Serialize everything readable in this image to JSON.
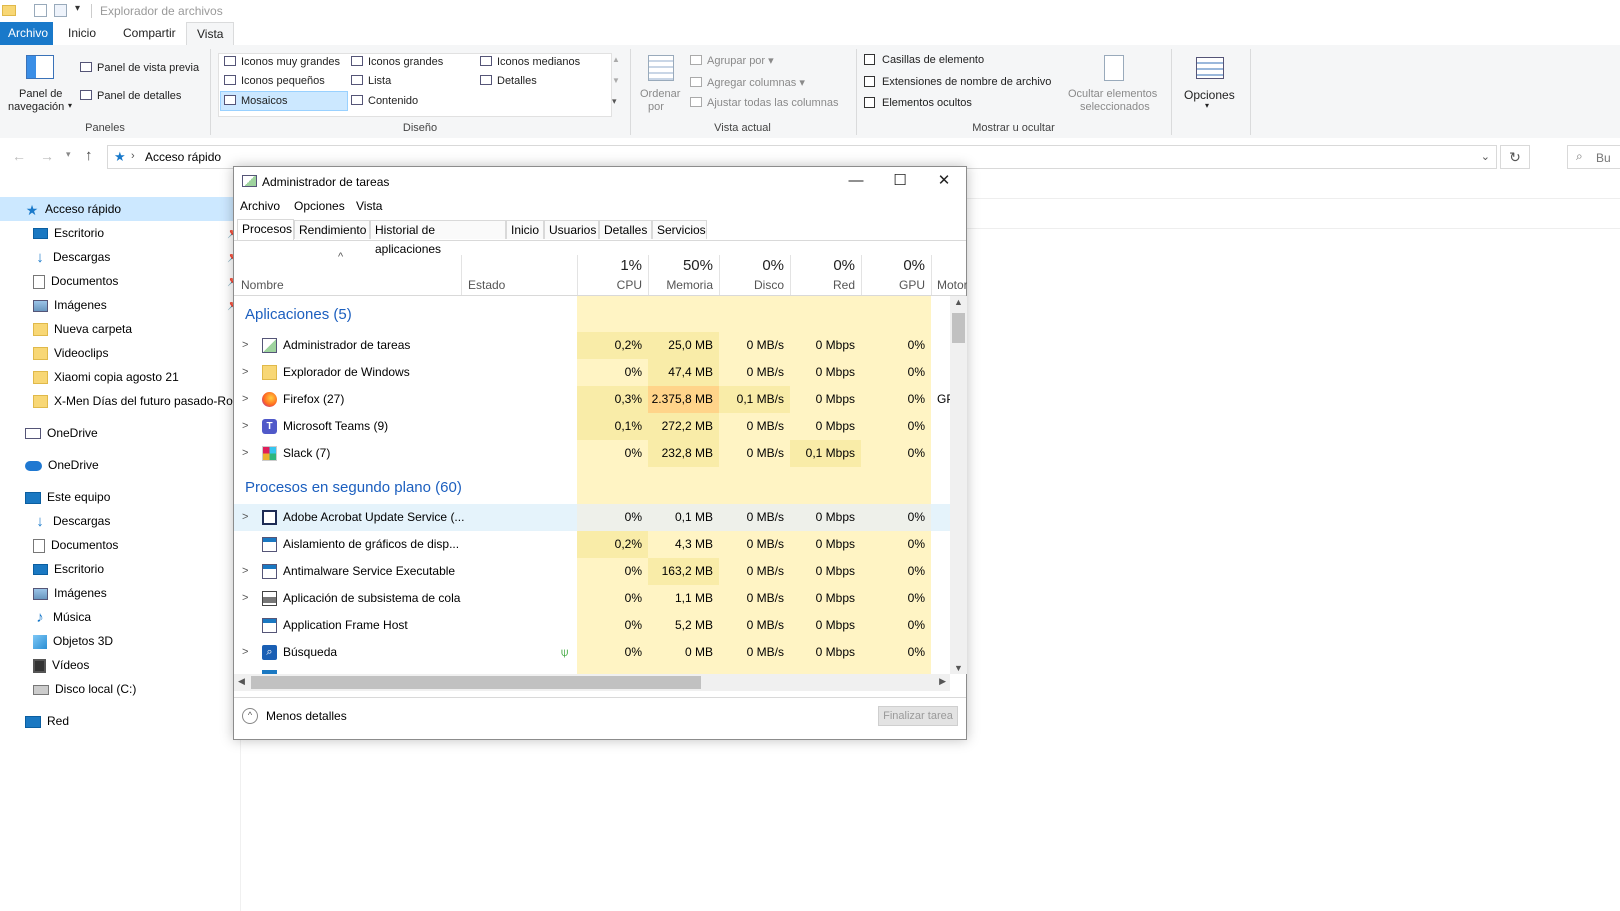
{
  "explorer": {
    "title": "Explorador de archivos",
    "tabs": {
      "file": "Archivo",
      "home": "Inicio",
      "share": "Compartir",
      "view": "Vista"
    },
    "ribbon": {
      "panels": {
        "nav_pane_line1": "Panel de",
        "nav_pane_line2": "navegación",
        "preview": "Panel de vista previa",
        "details": "Panel de detalles",
        "group": "Paneles"
      },
      "layout": {
        "xl_icons": "Iconos muy grandes",
        "l_icons": "Iconos grandes",
        "m_icons": "Iconos medianos",
        "s_icons": "Iconos pequeños",
        "list": "Lista",
        "details": "Detalles",
        "tiles": "Mosaicos",
        "content": "Contenido",
        "group": "Diseño"
      },
      "current_view": {
        "sort_line1": "Ordenar",
        "sort_line2": "por",
        "group_by": "Agrupar por",
        "add_columns": "Agregar columnas",
        "fit_columns": "Ajustar todas las columnas",
        "group": "Vista actual"
      },
      "show_hide": {
        "item_checkboxes": "Casillas de elemento",
        "file_ext": "Extensiones de nombre de archivo",
        "hidden_items": "Elementos ocultos",
        "hide_sel_line1": "Ocultar elementos",
        "hide_sel_line2": "seleccionados",
        "group": "Mostrar u ocultar"
      },
      "options": "Opciones"
    },
    "address": {
      "path": "Acceso rápido",
      "search_placeholder": "Bu"
    },
    "nav": {
      "quick_access": "Acceso rápido",
      "qa_items": [
        "Escritorio",
        "Descargas",
        "Documentos",
        "Imágenes",
        "Nueva carpeta",
        "Videoclips",
        "Xiaomi copia agosto 21",
        "X-Men Días del futuro pasado-Rogu"
      ],
      "onedrive1": "OneDrive",
      "onedrive2": "OneDrive",
      "this_pc": "Este equipo",
      "pc_items": [
        "Descargas",
        "Documentos",
        "Escritorio",
        "Imágenes",
        "Música",
        "Objetos 3D",
        "Vídeos",
        "Disco local (C:)"
      ],
      "network": "Red"
    }
  },
  "taskmgr": {
    "title": "Administrador de tareas",
    "menu": [
      "Archivo",
      "Opciones",
      "Vista"
    ],
    "tabs": [
      "Procesos",
      "Rendimiento",
      "Historial de aplicaciones",
      "Inicio",
      "Usuarios",
      "Detalles",
      "Servicios"
    ],
    "columns": {
      "name": "Nombre",
      "status": "Estado",
      "cpu_pct": "1%",
      "cpu": "CPU",
      "mem_pct": "50%",
      "mem": "Memoria",
      "disk_pct": "0%",
      "disk": "Disco",
      "net_pct": "0%",
      "net": "Red",
      "gpu_pct": "0%",
      "gpu": "GPU",
      "engine": "Motor"
    },
    "groups": {
      "apps": "Aplicaciones (5)",
      "background": "Procesos en segundo plano (60)"
    },
    "apps": [
      {
        "name": "Administrador de tareas",
        "cpu": "0,2%",
        "mem": "25,0 MB",
        "disk": "0 MB/s",
        "net": "0 Mbps",
        "gpu": "0%",
        "engine": ""
      },
      {
        "name": "Explorador de Windows",
        "cpu": "0%",
        "mem": "47,4 MB",
        "disk": "0 MB/s",
        "net": "0 Mbps",
        "gpu": "0%",
        "engine": ""
      },
      {
        "name": "Firefox (27)",
        "cpu": "0,3%",
        "mem": "2.375,8 MB",
        "disk": "0,1 MB/s",
        "net": "0 Mbps",
        "gpu": "0%",
        "engine": "GP"
      },
      {
        "name": "Microsoft Teams (9)",
        "cpu": "0,1%",
        "mem": "272,2 MB",
        "disk": "0 MB/s",
        "net": "0 Mbps",
        "gpu": "0%",
        "engine": ""
      },
      {
        "name": "Slack (7)",
        "cpu": "0%",
        "mem": "232,8 MB",
        "disk": "0 MB/s",
        "net": "0,1 Mbps",
        "gpu": "0%",
        "engine": ""
      }
    ],
    "background": [
      {
        "name": "Adobe Acrobat Update Service (...",
        "cpu": "0%",
        "mem": "0,1 MB",
        "disk": "0 MB/s",
        "net": "0 Mbps",
        "gpu": "0%"
      },
      {
        "name": "Aislamiento de gráficos de disp...",
        "cpu": "0,2%",
        "mem": "4,3 MB",
        "disk": "0 MB/s",
        "net": "0 Mbps",
        "gpu": "0%"
      },
      {
        "name": "Antimalware Service Executable",
        "cpu": "0%",
        "mem": "163,2 MB",
        "disk": "0 MB/s",
        "net": "0 Mbps",
        "gpu": "0%"
      },
      {
        "name": "Aplicación de subsistema de cola",
        "cpu": "0%",
        "mem": "1,1 MB",
        "disk": "0 MB/s",
        "net": "0 Mbps",
        "gpu": "0%"
      },
      {
        "name": "Application Frame Host",
        "cpu": "0%",
        "mem": "5,2 MB",
        "disk": "0 MB/s",
        "net": "0 Mbps",
        "gpu": "0%"
      },
      {
        "name": "Búsqueda",
        "cpu": "0%",
        "mem": "0 MB",
        "disk": "0 MB/s",
        "net": "0 Mbps",
        "gpu": "0%"
      }
    ],
    "footer": {
      "less_details": "Menos detalles",
      "end_task": "Finalizar tarea"
    }
  }
}
